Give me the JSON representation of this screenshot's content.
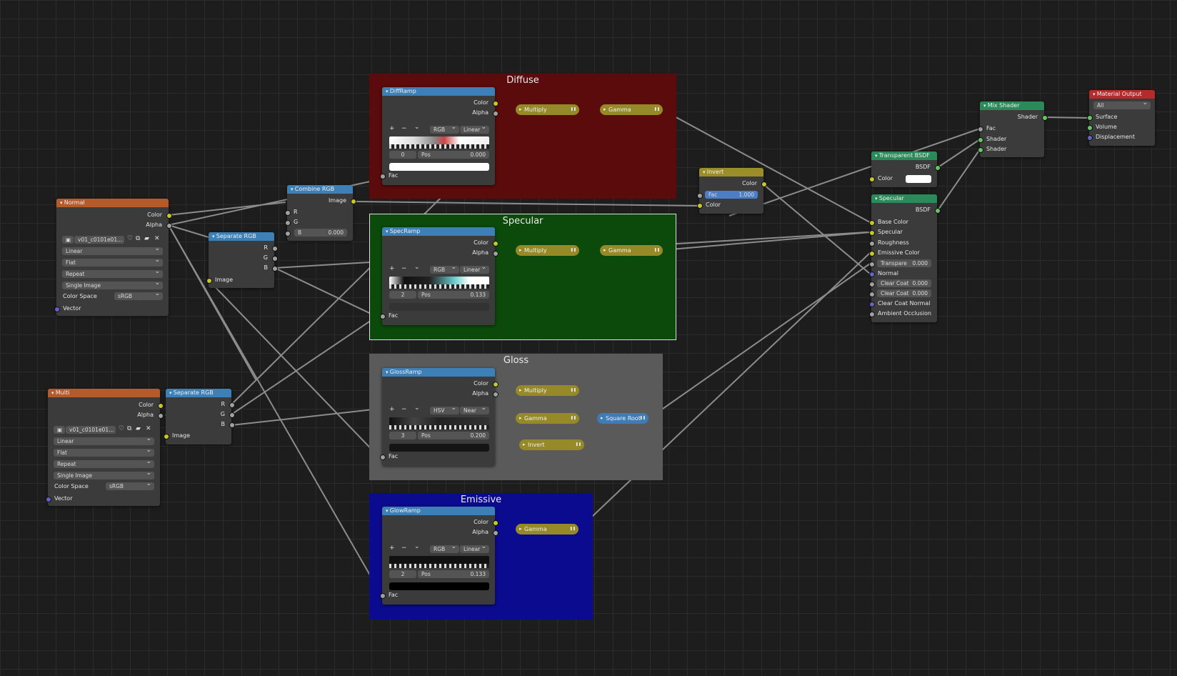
{
  "frames": {
    "diffuse": "Diffuse",
    "specular": "Specular",
    "gloss": "Gloss",
    "emissive": "Emissive"
  },
  "colors": {
    "diffuse": "#5b0b0b",
    "specular": "#0b4a0b",
    "gloss": "#5a5a5a",
    "emissive": "#0b0b8f",
    "texture_header": "#b55a2b",
    "converter_header": "#3d80b8",
    "math_header": "#9a8d2a",
    "shader_header": "#2b8a5a",
    "output_header": "#b52b2b"
  },
  "normal": {
    "title": "Normal",
    "out_color": "Color",
    "out_alpha": "Alpha",
    "image": "v01_c0101e01...",
    "interp": "Linear",
    "proj": "Flat",
    "ext": "Repeat",
    "src": "Single Image",
    "cs_label": "Color Space",
    "cs": "sRGB",
    "vector": "Vector"
  },
  "multi": {
    "title": "Multi",
    "out_color": "Color",
    "out_alpha": "Alpha",
    "image": "v01_c0101e01...",
    "interp": "Linear",
    "proj": "Flat",
    "ext": "Repeat",
    "src": "Single Image",
    "cs_label": "Color Space",
    "cs": "sRGB",
    "vector": "Vector"
  },
  "sep1": {
    "title": "Separate RGB",
    "r": "R",
    "g": "G",
    "b": "B",
    "image": "Image"
  },
  "sep2": {
    "title": "Separate RGB",
    "r": "R",
    "g": "G",
    "b": "B",
    "image": "Image"
  },
  "combine": {
    "title": "Combine RGB",
    "image": "Image",
    "r": "R",
    "g": "G",
    "b": "B",
    "bval": "0.000"
  },
  "ramps": {
    "diff": {
      "title": "DiffRamp",
      "color": "Color",
      "alpha": "Alpha",
      "mode": "RGB",
      "interp": "Linear",
      "idx": "0",
      "pos": "Pos",
      "posval": "0.000",
      "fac": "Fac"
    },
    "spec": {
      "title": "SpecRamp",
      "color": "Color",
      "alpha": "Alpha",
      "mode": "RGB",
      "interp": "Linear",
      "idx": "2",
      "pos": "Pos",
      "posval": "0.133",
      "fac": "Fac"
    },
    "gloss": {
      "title": "GlossRamp",
      "color": "Color",
      "alpha": "Alpha",
      "mode": "HSV",
      "interp": "Near",
      "idx": "3",
      "pos": "Pos",
      "posval": "0.200",
      "fac": "Fac"
    },
    "glow": {
      "title": "GlowRamp",
      "color": "Color",
      "alpha": "Alpha",
      "mode": "RGB",
      "interp": "Linear",
      "idx": "2",
      "pos": "Pos",
      "posval": "0.133",
      "fac": "Fac"
    }
  },
  "pills": {
    "multiply": "Multiply",
    "gamma": "Gamma",
    "invert": "Invert",
    "sqrt": "Square Root"
  },
  "invert": {
    "title": "Invert",
    "color_out": "Color",
    "fac": "Fac",
    "facval": "1.000",
    "color_in": "Color"
  },
  "transparent": {
    "title": "Transparent BSDF",
    "bsdf": "BSDF",
    "color": "Color"
  },
  "specular": {
    "title": "Specular",
    "bsdf": "BSDF",
    "base": "Base Color",
    "spec": "Specular",
    "rough": "Roughness",
    "emis": "Emissive Color",
    "transp": "Transpare",
    "transpval": "0.000",
    "normal": "Normal",
    "cc1": "Clear Coat",
    "cc1val": "0.000",
    "cc2": "Clear Coat",
    "cc2val": "0.000",
    "ccn": "Clear Coat Normal",
    "ao": "Ambient Occlusion"
  },
  "mix": {
    "title": "Mix Shader",
    "shader_out": "Shader",
    "fac": "Fac",
    "s1": "Shader",
    "s2": "Shader"
  },
  "output": {
    "title": "Material Output",
    "target": "All",
    "surface": "Surface",
    "volume": "Volume",
    "disp": "Displacement"
  },
  "ramp_buttons": {
    "add": "+",
    "remove": "−",
    "menu": "⌄"
  }
}
